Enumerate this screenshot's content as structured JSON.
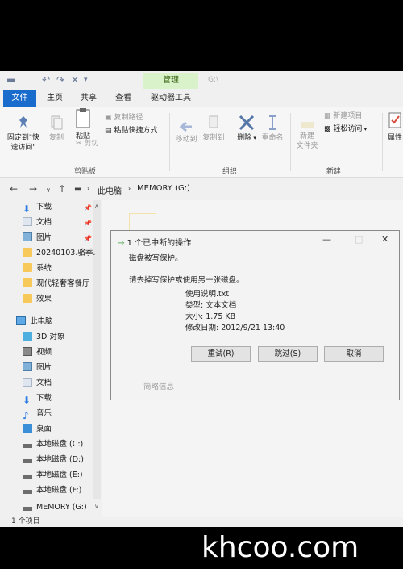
{
  "window": {
    "context_tab": "管理",
    "ghost_title": "G:\\",
    "quick_access_icons": [
      "undo-icon",
      "redo-icon",
      "delete-icon",
      "customize-icon"
    ]
  },
  "tabs": [
    "文件",
    "主页",
    "共享",
    "查看",
    "驱动器工具"
  ],
  "ribbon": {
    "pin_label": "固定到\"快\n速访问\"",
    "copy_label": "复制",
    "paste_label": "粘贴",
    "copy_path_label": "复制路径",
    "paste_shortcut_label": "粘贴快捷方式",
    "cut_label": "剪切",
    "move_to_label": "移动到",
    "copy_to_label": "复制到",
    "delete_label": "删除",
    "rename_label": "重命名",
    "new_folder_label": "新建\n文件夹",
    "new_item_label": "新建项目",
    "easy_access_label": "轻松访问",
    "properties_label": "属性",
    "groups": [
      "剪贴板",
      "组织",
      "新建"
    ]
  },
  "address": {
    "crumbs": [
      "此电脑",
      "MEMORY (G:)"
    ]
  },
  "sidebar": {
    "quick_access": [
      {
        "label": "下载",
        "pinned": true
      },
      {
        "label": "文档",
        "pinned": true
      },
      {
        "label": "图片",
        "pinned": true
      },
      {
        "label": "20240103.骆季..."
      },
      {
        "label": "系统"
      },
      {
        "label": "现代轻奢客餐厅"
      },
      {
        "label": "效果"
      }
    ],
    "this_pc_label": "此电脑",
    "this_pc_items": [
      "3D 对象",
      "视频",
      "图片",
      "文档",
      "下载",
      "音乐",
      "桌面",
      "本地磁盘 (C:)",
      "本地磁盘 (D:)",
      "本地磁盘 (E:)",
      "本地磁盘 (F:)",
      "MEMORY (G:)"
    ]
  },
  "dialog": {
    "title": "1 个已中断的操作",
    "message1": "磁盘被写保护。",
    "message2": "请去掉写保护或使用另一张磁盘。",
    "file_name": "使用说明.txt",
    "file_type": "类型: 文本文档",
    "file_size": "大小: 1.75 KB",
    "file_modified": "修改日期: 2012/9/21 13:40",
    "retry_label": "重试(R)",
    "skip_label": "跳过(S)",
    "cancel_label": "取消",
    "details_label": "简略信息"
  },
  "status": {
    "item_count": "1 个项目"
  },
  "watermark": "khcoo.com",
  "colors": {
    "accent": "#1a6ccc",
    "context_tab_bg": "#d9f2c9",
    "folder": "#f6c95a"
  }
}
